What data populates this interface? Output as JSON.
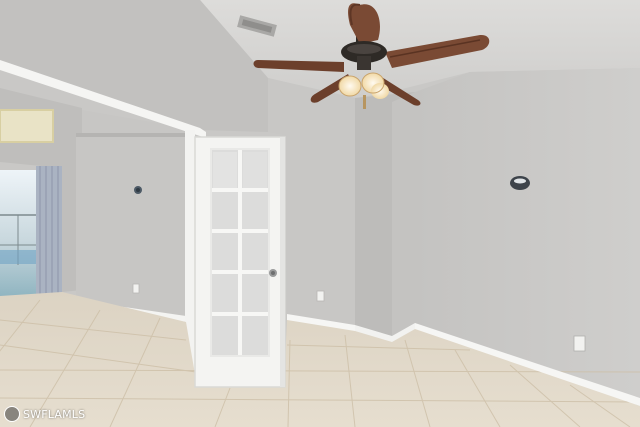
{
  "photo": {
    "subject": "empty-room-with-french-door-and-ceiling-fan",
    "watermark": {
      "text": "SWFLAMLS",
      "icon": "mls-badge-icon"
    }
  },
  "colors": {
    "wall": "#c6c5c3",
    "wall_shadow": "#b7b6b4",
    "ceiling": "#d6d5d3",
    "floor": "#ddd3c0",
    "grout": "#cbbfa9",
    "trim": "#f7f7f5",
    "door": "#f4f4f2",
    "glass": "#dcdcdb",
    "fan_wood": "#7a4a34",
    "fan_metal": "#2e2a26",
    "light_glow": "#fff4d8"
  }
}
